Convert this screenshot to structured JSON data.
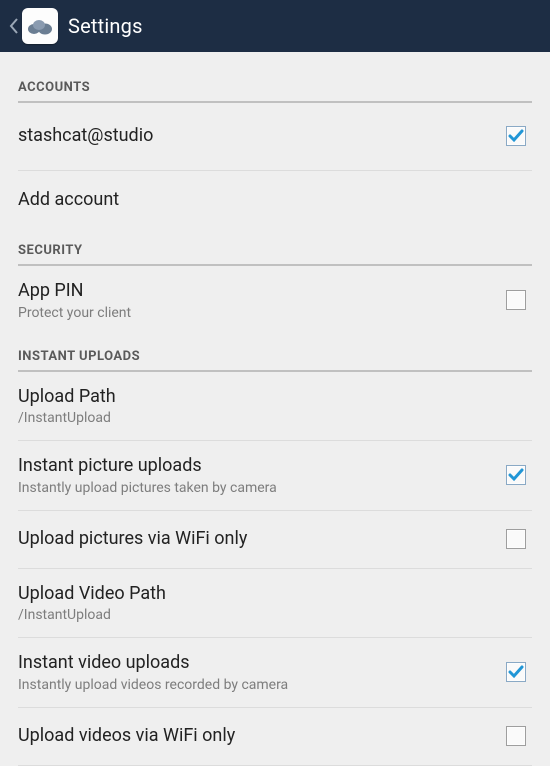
{
  "header": {
    "title": "Settings"
  },
  "sections": {
    "accounts": {
      "label": "ACCOUNTS",
      "account_name": "stashcat@studio",
      "add_label": "Add account"
    },
    "security": {
      "label": "SECURITY",
      "app_pin": {
        "title": "App PIN",
        "sub": "Protect your client",
        "checked": false
      }
    },
    "instant": {
      "label": "INSTANT UPLOADS",
      "upload_path": {
        "title": "Upload Path",
        "sub": "/InstantUpload"
      },
      "pic_uploads": {
        "title": "Instant picture uploads",
        "sub": "Instantly upload pictures taken by camera",
        "checked": true
      },
      "pic_wifi": {
        "title": "Upload pictures via WiFi only",
        "checked": false
      },
      "vid_path": {
        "title": "Upload Video Path",
        "sub": "/InstantUpload"
      },
      "vid_uploads": {
        "title": "Instant video uploads",
        "sub": "Instantly upload videos recorded by camera",
        "checked": true
      },
      "vid_wifi": {
        "title": "Upload videos via WiFi only",
        "checked": false
      }
    }
  }
}
